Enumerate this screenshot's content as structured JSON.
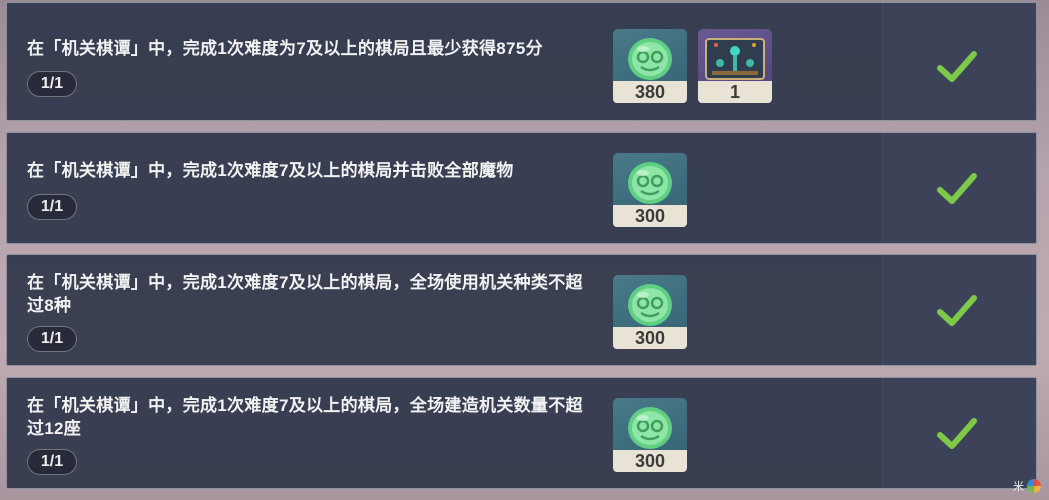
{
  "quests": [
    {
      "description": "在「机关棋谭」中，完成1次难度为7及以上的棋局且最少获得875分",
      "progress": "1/1",
      "rewards": [
        {
          "icon": "green-coin-icon",
          "count": "380"
        },
        {
          "icon": "decoration-item-icon",
          "count": "1"
        }
      ]
    },
    {
      "description": "在「机关棋谭」中，完成1次难度7及以上的棋局并击败全部魔物",
      "progress": "1/1",
      "rewards": [
        {
          "icon": "green-coin-icon",
          "count": "300"
        }
      ]
    },
    {
      "description": "在「机关棋谭」中，完成1次难度7及以上的棋局，全场使用机关种类不超过8种",
      "progress": "1/1",
      "rewards": [
        {
          "icon": "green-coin-icon",
          "count": "300"
        }
      ]
    },
    {
      "description": "在「机关棋谭」中，完成1次难度7及以上的棋局，全场建造机关数量不超过12座",
      "progress": "1/1",
      "rewards": [
        {
          "icon": "green-coin-icon",
          "count": "300"
        }
      ]
    }
  ],
  "colors": {
    "check": "#7ec84a",
    "row_background": "#343a4e",
    "count_bar": "#e9e3d6"
  },
  "watermark": {
    "text": "米"
  }
}
